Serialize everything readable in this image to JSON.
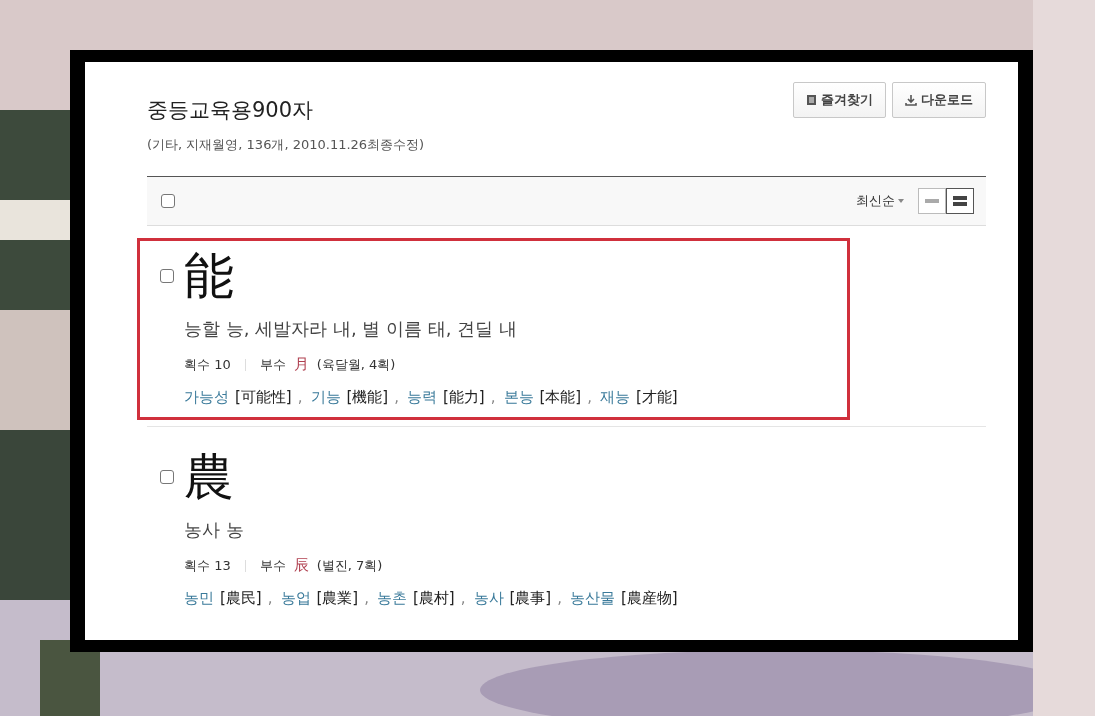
{
  "title": "중등교육용900자",
  "meta": "(기타, 지재월영, 136개, 2010.11.26최종수정)",
  "buttons": [
    {
      "kind": "favorite",
      "label": "즐겨찾기"
    },
    {
      "kind": "download",
      "label": "다운로드"
    }
  ],
  "toolbar": {
    "select_all_checked": false,
    "sort_label": "최신순",
    "views": [
      {
        "kind": "single",
        "selected": false
      },
      {
        "kind": "double",
        "selected": true
      }
    ]
  },
  "word_separator": ",",
  "entries": [
    {
      "char": "能",
      "checked": false,
      "highlighted": true,
      "meaning": "능할 능, 세발자라 내, 별 이름 태, 견딜 내",
      "strokes": "획수 10",
      "radical_label": "부수",
      "radical": "月",
      "radical_info": "(육달월, 4획)",
      "words": [
        {
          "hangul": "가능성",
          "hanja": "[可能性]"
        },
        {
          "hangul": "기능",
          "hanja": "[機能]"
        },
        {
          "hangul": "능력",
          "hanja": "[能力]"
        },
        {
          "hangul": "본능",
          "hanja": "[本能]"
        },
        {
          "hangul": "재능",
          "hanja": "[才能]"
        }
      ]
    },
    {
      "char": "農",
      "checked": false,
      "highlighted": false,
      "meaning": "농사 농",
      "strokes": "획수 13",
      "radical_label": "부수",
      "radical": "辰",
      "radical_info": "(별진, 7획)",
      "words": [
        {
          "hangul": "농민",
          "hanja": "[農民]"
        },
        {
          "hangul": "농업",
          "hanja": "[農業]"
        },
        {
          "hangul": "농촌",
          "hanja": "[農村]"
        },
        {
          "hangul": "농사",
          "hanja": "[農事]"
        },
        {
          "hangul": "농산물",
          "hanja": "[農産物]"
        }
      ]
    }
  ]
}
